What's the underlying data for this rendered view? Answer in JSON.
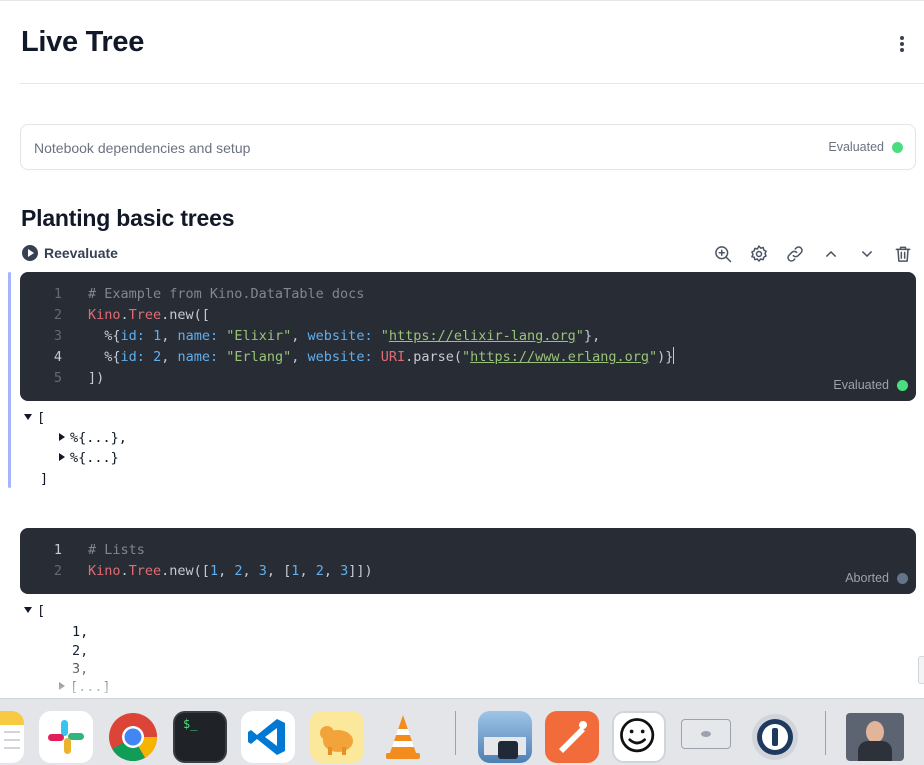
{
  "notebook": {
    "title": "Live Tree",
    "menu_icon": "kebab-vertical-icon"
  },
  "setup_section": {
    "label": "Notebook dependencies and setup",
    "status": "Evaluated",
    "status_color": "#4ade80"
  },
  "section": {
    "heading": "Planting basic trees",
    "reevaluate_label": "Reevaluate",
    "toolbar_icons": [
      "zoom-in-icon",
      "gear-icon",
      "link-icon",
      "chevron-up-icon",
      "chevron-down-icon",
      "trash-icon"
    ]
  },
  "cell1": {
    "status": "Evaluated",
    "status_color": "#4ade80",
    "lines": [
      {
        "n": "1",
        "comment": "# Example from Kino.DataTable docs"
      },
      {
        "n": "2",
        "mod_a": "Kino",
        "mod_b": "Tree",
        "fn": ".new([",
        "dot": "."
      },
      {
        "n": "3",
        "open": "%{",
        "k1": "id:",
        "v1": "1",
        "k2": "name:",
        "v2": "\"Elixir\"",
        "k3": "website:",
        "q1": "\"",
        "url": "https://elixir-lang.org",
        "q2": "\"",
        "close": "},"
      },
      {
        "n": "4",
        "open": "%{",
        "k1": "id:",
        "v1": "2",
        "k2": "name:",
        "v2": "\"Erlang\"",
        "k3": "website:",
        "mod": "URI",
        "fn": ".parse(",
        "q1": "\"",
        "url": "https://www.erlang.org",
        "q2": "\"",
        "close": ")}"
      },
      {
        "n": "5",
        "text": "])"
      }
    ]
  },
  "output1": {
    "open": "[",
    "items": [
      "%{...},",
      "%{...}"
    ],
    "close": "]"
  },
  "cell2": {
    "status": "Aborted",
    "status_color": "#64748b",
    "lines": [
      {
        "n": "1",
        "comment": "# Lists"
      },
      {
        "n": "2",
        "mod_a": "Kino",
        "mod_b": "Tree",
        "fn": ".new([",
        "nums": [
          "1",
          "2",
          "3"
        ],
        "inner": [
          "1",
          "2",
          "3"
        ]
      }
    ]
  },
  "output2": {
    "open": "[",
    "items": [
      "1,",
      "2,",
      "3,"
    ],
    "collapsed": "[...]"
  },
  "dock": {
    "apps": [
      "notes-icon",
      "slack-icon",
      "chrome-icon",
      "terminal-icon",
      "vscode-icon",
      "tableplus-icon",
      "vlc-icon",
      "preview-icon",
      "postman-icon",
      "face-app-icon",
      "printer-icon",
      "1password-icon",
      "video-thumbnail-icon"
    ]
  }
}
